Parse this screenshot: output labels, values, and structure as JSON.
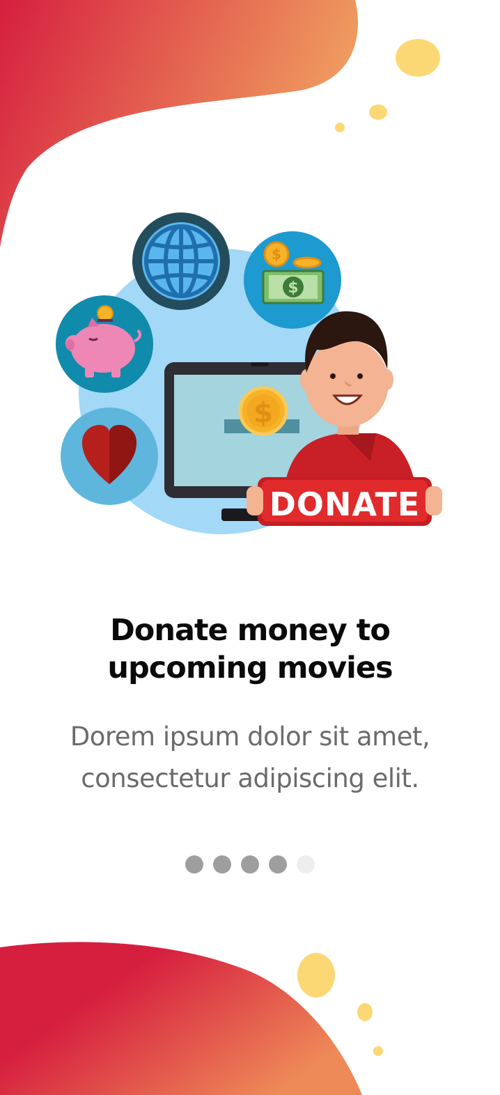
{
  "onboarding": {
    "title_line1": "Donate money to",
    "title_line2": "upcoming movies",
    "subtitle_line1": "Dorem ipsum dolor sit amet,",
    "subtitle_line2": "consectetur adipiscing elit."
  },
  "illustration": {
    "sign_text": "DONATE",
    "coin_symbol": "$",
    "icons": [
      "globe-icon",
      "money-icon",
      "piggy-bank-icon",
      "heart-icon",
      "computer-icon",
      "person-icon"
    ]
  },
  "pagination": {
    "total": 5,
    "active_index": 4
  },
  "colors": {
    "brand_red": "#d61f3f",
    "brand_orange": "#ef9a60",
    "accent_yellow": "#fcd875",
    "dot_inactive": "#9e9e9e",
    "dot_active": "#eeeeee"
  }
}
